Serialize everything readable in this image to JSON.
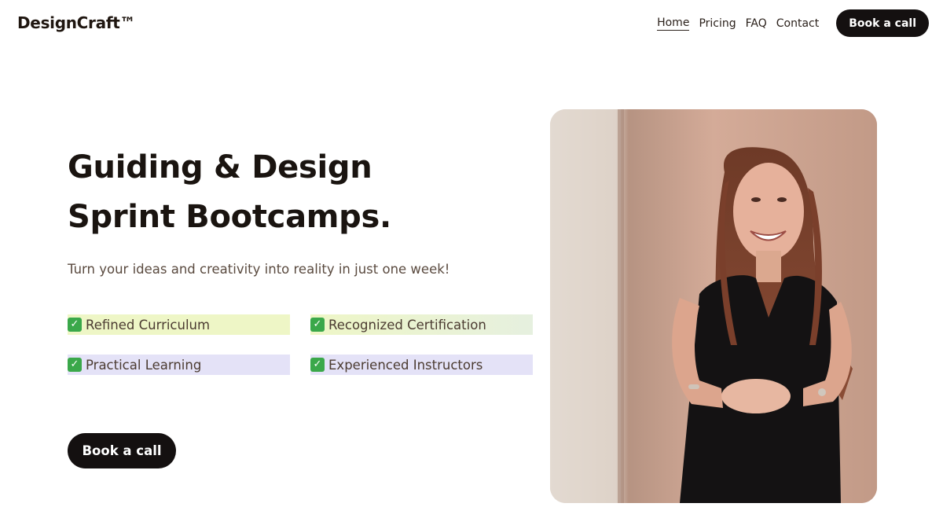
{
  "header": {
    "logo": "DesignCraft™",
    "nav": [
      {
        "label": "Home",
        "active": true
      },
      {
        "label": "Pricing",
        "active": false
      },
      {
        "label": "FAQ",
        "active": false
      },
      {
        "label": "Contact",
        "active": false
      }
    ],
    "cta_label": "Book a call"
  },
  "hero": {
    "title_line1": "Guiding & Design",
    "title_line2": "Sprint Bootcamps.",
    "subtitle": "Turn your ideas and creativity into reality in just one week!",
    "features": [
      {
        "label": "Refined Curriculum",
        "icon": "check-box-icon"
      },
      {
        "label": "Recognized Certification",
        "icon": "check-box-icon"
      },
      {
        "label": "Practical Learning",
        "icon": "check-box-icon"
      },
      {
        "label": "Experienced Instructors",
        "icon": "check-box-icon"
      }
    ],
    "cta_label": "Book a call",
    "check_glyph": "✓"
  },
  "colors": {
    "cta_bg": "#141010",
    "feature_lime": "#eef6c6",
    "feature_lavender": "#e4e2f7",
    "check_green": "#3aa84a"
  }
}
